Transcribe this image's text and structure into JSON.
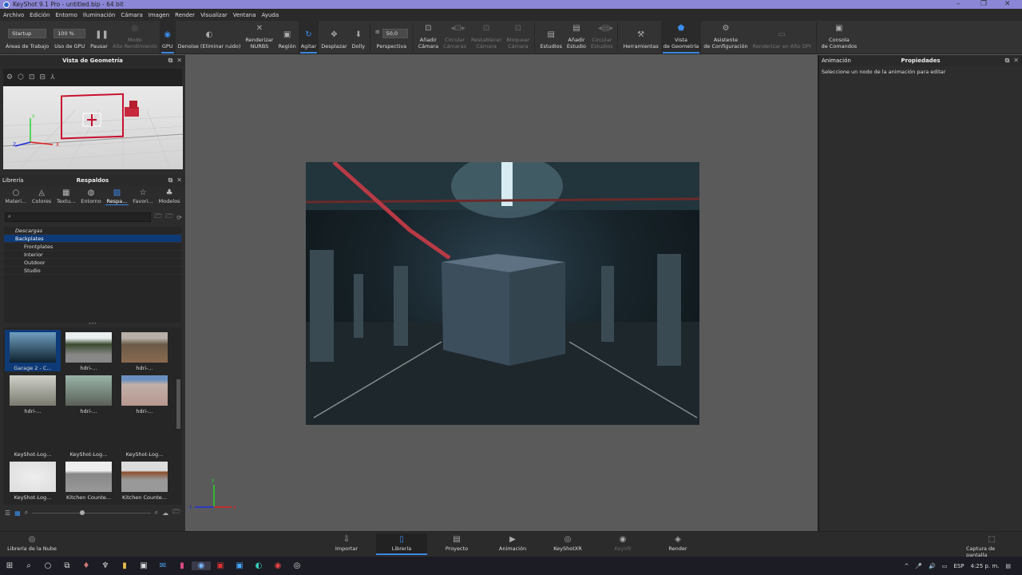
{
  "window": {
    "title": "KeyShot 9.1 Pro  - untitled.bip  - 64 bit",
    "minimize": "–",
    "maximize": "❐",
    "close": "✕"
  },
  "menu": [
    "Archivo",
    "Edición",
    "Entorno",
    "Iluminación",
    "Cámara",
    "Imagen",
    "Render",
    "Visualizar",
    "Ventana",
    "Ayuda"
  ],
  "toolbar": {
    "workspace_value": "Startup",
    "workspace_label": "Áreas de Trabajo",
    "gpu_usage_value": "100 %",
    "gpu_usage_label": "Uso de GPU",
    "fov_value": "50,0",
    "perspective_label": "Perspectiva",
    "items": [
      {
        "label": "Pausar",
        "icon": "pause-icon",
        "glyph": "❚❚"
      },
      {
        "label": "Modo\nAlto Rendimiento",
        "icon": "performance-icon",
        "glyph": "◎",
        "disabled": true
      },
      {
        "label": "GPU",
        "icon": "gpu-icon",
        "glyph": "◉",
        "active": true
      },
      {
        "label": "Denoise (Eliminar ruido)",
        "icon": "denoise-icon",
        "glyph": "◐"
      },
      {
        "label": "Renderizar\nNURBS",
        "icon": "nurbs-icon",
        "glyph": "✕"
      },
      {
        "label": "Región",
        "icon": "region-icon",
        "glyph": "▣"
      },
      {
        "label": "Agitar",
        "icon": "tumble-icon",
        "glyph": "↻",
        "active": true
      },
      {
        "label": "Desplazar",
        "icon": "pan-icon",
        "glyph": "✥"
      },
      {
        "label": "Dolly",
        "icon": "dolly-icon",
        "glyph": "⬇"
      }
    ],
    "items2": [
      {
        "label": "Añadir\nCámara",
        "icon": "add-camera-icon",
        "glyph": "⊡"
      },
      {
        "label": "Circular\nCámaras",
        "icon": "cycle-cameras-icon",
        "glyph": "◂⊡▸",
        "disabled": true
      },
      {
        "label": "Restablecer\nCámara",
        "icon": "reset-camera-icon",
        "glyph": "⊡",
        "disabled": true
      },
      {
        "label": "Bloquear\nCámara",
        "icon": "lock-camera-icon",
        "glyph": "⊡",
        "disabled": true
      },
      {
        "label": "Estudios",
        "icon": "studios-icon",
        "glyph": "▤"
      },
      {
        "label": "Añadir\nEstudio",
        "icon": "add-studio-icon",
        "glyph": "▤"
      },
      {
        "label": "Circular\nEstudios",
        "icon": "cycle-studios-icon",
        "glyph": "◂▤▸",
        "disabled": true
      },
      {
        "label": "Herramientas",
        "icon": "tools-icon",
        "glyph": "⚒"
      },
      {
        "label": "Vista\nde Geometría",
        "icon": "geometry-view-icon",
        "glyph": "⬟",
        "active": true
      },
      {
        "label": "Asistente\nde Configuración",
        "icon": "config-wizard-icon",
        "glyph": "⚙"
      },
      {
        "label": "Renderizar en Alto DPI",
        "icon": "monitor-icon",
        "glyph": "▭",
        "disabled": true
      },
      {
        "label": "Consola\nde Comandos",
        "icon": "console-icon",
        "glyph": "▣"
      }
    ]
  },
  "geometry_view": {
    "title": "Vista de Geometría",
    "axis_x": "X",
    "axis_y": "Y",
    "axis_z": "Z"
  },
  "library": {
    "left_label": "Librería",
    "title": "Respaldos",
    "tabs": [
      {
        "label": "Materi...",
        "glyph": "○"
      },
      {
        "label": "Colores",
        "glyph": "◬"
      },
      {
        "label": "Textu...",
        "glyph": "▦"
      },
      {
        "label": "Entorno",
        "glyph": "◍"
      },
      {
        "label": "Respa...",
        "glyph": "▨",
        "active": true
      },
      {
        "label": "Favori...",
        "glyph": "☆"
      },
      {
        "label": "Modelos",
        "glyph": "♣"
      }
    ],
    "search_placeholder": "",
    "tree": [
      "Descargas",
      "Backplates",
      "Frontplates",
      "Interior",
      "Outdoor",
      "Studio"
    ],
    "thumbs": [
      "Garage 2 - C...",
      "hdri-...",
      "hdri-...",
      "hdri-...",
      "hdri-...",
      "hdri-...",
      "KeyShot-Log...",
      "KeyShot-Log...",
      "KeyShot-Log...",
      "KeyShot-Log...",
      "Kitchen Counte...",
      "Kitchen Counte..."
    ]
  },
  "viewport": {
    "axis_x": "x",
    "axis_y": "y",
    "axis_z": "z"
  },
  "properties": {
    "tab_animation": "Animación",
    "title": "Propiedades",
    "message": "Seleccione un nodo de la animación para editar"
  },
  "bottombar": {
    "cloud_library": "Librería de la Nube",
    "screenshot": "Captura de pantalla",
    "items": [
      {
        "label": "Importar",
        "glyph": "⇩"
      },
      {
        "label": "Librería",
        "glyph": "▯",
        "active": true
      },
      {
        "label": "Proyecto",
        "glyph": "▤"
      },
      {
        "label": "Animación",
        "glyph": "▶"
      },
      {
        "label": "KeyShotXR",
        "glyph": "◎"
      },
      {
        "label": "KeyVR",
        "glyph": "◉",
        "disabled": true
      },
      {
        "label": "Render",
        "glyph": "◈"
      }
    ]
  },
  "taskbar": {
    "language": "ESP",
    "time": "4:25 p. m."
  }
}
